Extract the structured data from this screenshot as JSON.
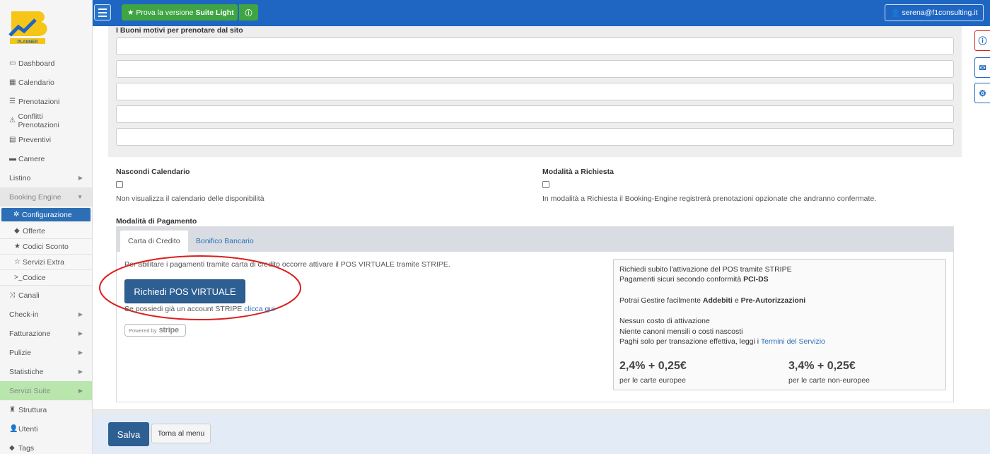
{
  "topbar": {
    "suite_prefix": "Prova la versione",
    "suite_name": "Suite Light",
    "user_email": "serena@f1consulting.it"
  },
  "logo": {
    "text": "PLANNER"
  },
  "sidebar": {
    "items": [
      {
        "label": "Dashboard",
        "icon": "monitor-icon"
      },
      {
        "label": "Calendario",
        "icon": "calendar-icon"
      },
      {
        "label": "Prenotazioni",
        "icon": "list-icon"
      },
      {
        "label": "Conflitti Prenotazioni",
        "icon": "warning-icon"
      },
      {
        "label": "Preventivi",
        "icon": "document-icon"
      },
      {
        "label": "Camere",
        "icon": "bed-icon"
      },
      {
        "label": "Listino",
        "icon": ""
      },
      {
        "label": "Booking Engine",
        "icon": ""
      }
    ],
    "sub_items": [
      {
        "label": "Configurazione",
        "icon": "gear-icon"
      },
      {
        "label": "Offerte",
        "icon": "tag-icon"
      },
      {
        "label": "Codici Sconto",
        "icon": "star-icon"
      },
      {
        "label": "Servizi Extra",
        "icon": "star-outline-icon"
      },
      {
        "label": "Codice",
        "icon": "terminal-icon"
      }
    ],
    "items2": [
      {
        "label": "Canali",
        "icon": "shuffle-icon"
      },
      {
        "label": "Check-in",
        "icon": ""
      },
      {
        "label": "Fatturazione",
        "icon": ""
      },
      {
        "label": "Pulizie",
        "icon": ""
      },
      {
        "label": "Statistiche",
        "icon": ""
      },
      {
        "label": "Servizi Suite",
        "icon": ""
      },
      {
        "label": "Struttura",
        "icon": "building-icon"
      },
      {
        "label": "Utenti",
        "icon": "user-icon"
      },
      {
        "label": "Tags",
        "icon": "tags-icon"
      }
    ]
  },
  "main": {
    "reasons_label": "I Buoni motivi per prenotare dal sito",
    "hide_calendar": {
      "label": "Nascondi Calendario",
      "help": "Non visualizza il calendario delle disponibilità"
    },
    "request_mode": {
      "label": "Modalità a Richiesta",
      "help": "In modalità a Richiesta il Booking-Engine registrerà prenotazioni opzionate che andranno confermate."
    },
    "payment": {
      "label": "Modalità di Pagamento",
      "tabs": [
        "Carta di Credito",
        "Bonifico Bancario"
      ],
      "intro": "Per abilitare i pagamenti tramite carta di credito occorre attivare il POS VIRTUALE tramite STRIPE.",
      "pos_button": "Richiedi POS VIRTUALE",
      "account_text": "Se possiedi già un account STRIPE",
      "account_link": "clicca qui",
      "powered_by": "Powered by",
      "powered_brand": "stripe"
    },
    "info": {
      "line1": "Richiedi subito l'attivazione del POS tramite STRIPE",
      "line2_prefix": "Pagamenti sicuri secondo conformità",
      "line2_bold": "PCI-DS",
      "line3_prefix": "Potrai Gestire facilmente",
      "line3_bold1": "Addebiti",
      "line3_mid": "e",
      "line3_bold2": "Pre-Autorizzazioni",
      "line4": "Nessun costo di attivazione",
      "line5": "Niente canoni mensili o costi nascosti",
      "line6_prefix": "Paghi solo per transazione effettiva, leggi i",
      "line6_link": "Termini del Servizio",
      "price_eu": "2,4% + 0,25€",
      "price_eu_sub": "per le carte europee",
      "price_noneu": "3,4% + 0,25€",
      "price_noneu_sub": "per le carte non-europee"
    }
  },
  "footer": {
    "save": "Salva",
    "back": "Torna al menu"
  },
  "colors": {
    "primary": "#1f66c2",
    "success": "#3fa443",
    "button_dark": "#2d5f93",
    "annotation": "#d9201c"
  }
}
